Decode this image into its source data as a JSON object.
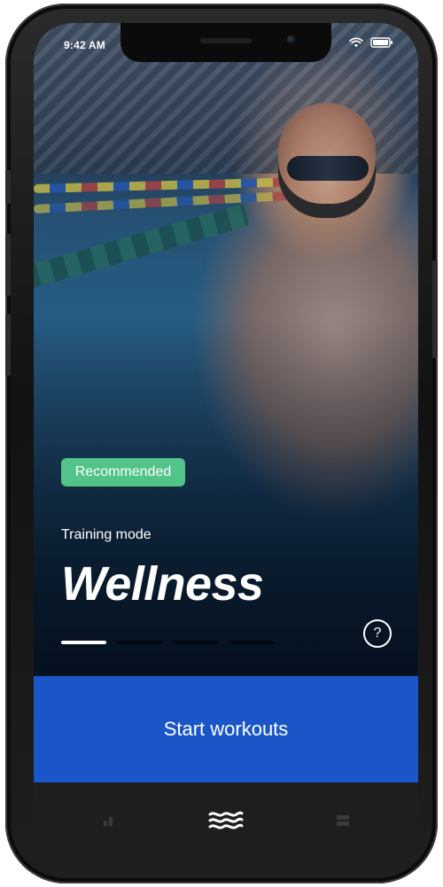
{
  "status_bar": {
    "time": "9:42 AM",
    "icons": [
      "wifi-icon",
      "battery-icon"
    ]
  },
  "hero": {
    "badge": "Recommended",
    "subtitle": "Training mode",
    "title": "Wellness",
    "pager": {
      "current": 1,
      "total": 4
    },
    "help_label": "?"
  },
  "cta": {
    "label": "Start workouts"
  },
  "tabbar": {
    "tabs": [
      {
        "name": "stats",
        "icon": "bar-chart-icon",
        "active": false
      },
      {
        "name": "workouts",
        "icon": "waves-icon",
        "active": true
      },
      {
        "name": "more",
        "icon": "grid-icon",
        "active": false
      }
    ]
  },
  "colors": {
    "badge": "#52c48a",
    "cta": "#1b56c8",
    "tabbar": "#1e1e1e",
    "text": "#ffffff"
  }
}
